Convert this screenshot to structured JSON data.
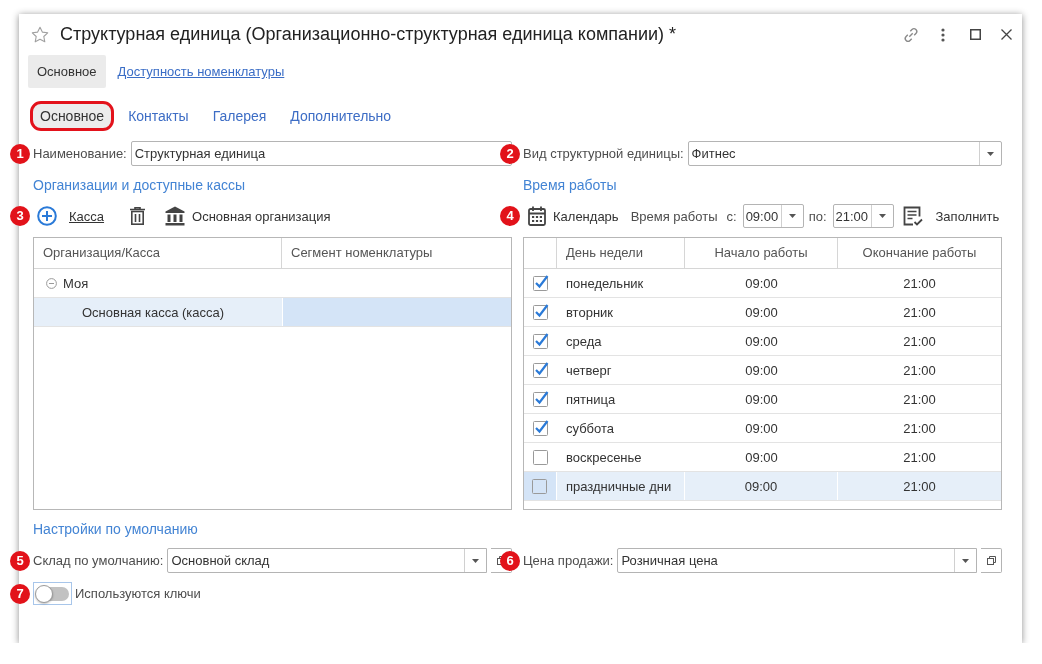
{
  "window": {
    "title": "Структурная единица (Организационно-структурная единица компании) *"
  },
  "nav": [
    {
      "label": "Основное",
      "selected": true
    },
    {
      "label": "Доступность номенклатуры",
      "selected": false
    }
  ],
  "tabs": [
    {
      "label": "Основное",
      "selected": true,
      "highlighted": true
    },
    {
      "label": "Контакты",
      "selected": false,
      "highlighted": false
    },
    {
      "label": "Галерея",
      "selected": false,
      "highlighted": false
    },
    {
      "label": "Дополнительно",
      "selected": false,
      "highlighted": false
    }
  ],
  "name_field": {
    "marker": "1",
    "label": "Наименование:",
    "value": "Структурная единица"
  },
  "type_field": {
    "marker": "2",
    "label": "Вид структурной единицы:",
    "value": "Фитнес"
  },
  "organizations": {
    "heading": "Организации и доступные кассы",
    "marker": "3",
    "toolbar": [
      {
        "kind": "add",
        "label": "Касса"
      },
      {
        "kind": "delete"
      },
      {
        "kind": "organization",
        "label": "Основная организация"
      }
    ],
    "columns": [
      "Организация/Касса",
      "Сегмент номенклатуры"
    ],
    "rows": [
      {
        "name": "Моя",
        "expanded": true,
        "selected": false,
        "children": [
          {
            "name": "Основная касса (касса)",
            "selected": true
          }
        ]
      }
    ]
  },
  "schedule": {
    "heading": "Время работы",
    "marker": "4",
    "calendar_label": "Календарь",
    "hours_label": "Время работы",
    "from_label": "с:",
    "from": "09:00",
    "to_label": "по:",
    "to": "21:00",
    "fill_label": "Заполнить",
    "columns": [
      "День недели",
      "Начало работы",
      "Окончание работы"
    ],
    "rows": [
      {
        "checked": true,
        "selected": false,
        "day": "понедельник",
        "start": "09:00",
        "end": "21:00"
      },
      {
        "checked": true,
        "selected": false,
        "day": "вторник",
        "start": "09:00",
        "end": "21:00"
      },
      {
        "checked": true,
        "selected": false,
        "day": "среда",
        "start": "09:00",
        "end": "21:00"
      },
      {
        "checked": true,
        "selected": false,
        "day": "четверг",
        "start": "09:00",
        "end": "21:00"
      },
      {
        "checked": true,
        "selected": false,
        "day": "пятница",
        "start": "09:00",
        "end": "21:00"
      },
      {
        "checked": true,
        "selected": false,
        "day": "суббота",
        "start": "09:00",
        "end": "21:00"
      },
      {
        "checked": false,
        "selected": false,
        "day": "воскресенье",
        "start": "09:00",
        "end": "21:00"
      },
      {
        "checked": false,
        "selected": true,
        "day": "праздничные дни",
        "start": "09:00",
        "end": "21:00"
      }
    ]
  },
  "defaults": {
    "heading": "Настройки по умолчанию",
    "warehouse_field": {
      "marker": "5",
      "label": "Склад по умолчанию:",
      "value": "Основной склад"
    },
    "price_field": {
      "marker": "6",
      "label": "Цена продажи:",
      "value": "Розничная цена"
    },
    "keys_toggle": {
      "marker": "7",
      "label": "Используются ключи",
      "on": false
    }
  }
}
